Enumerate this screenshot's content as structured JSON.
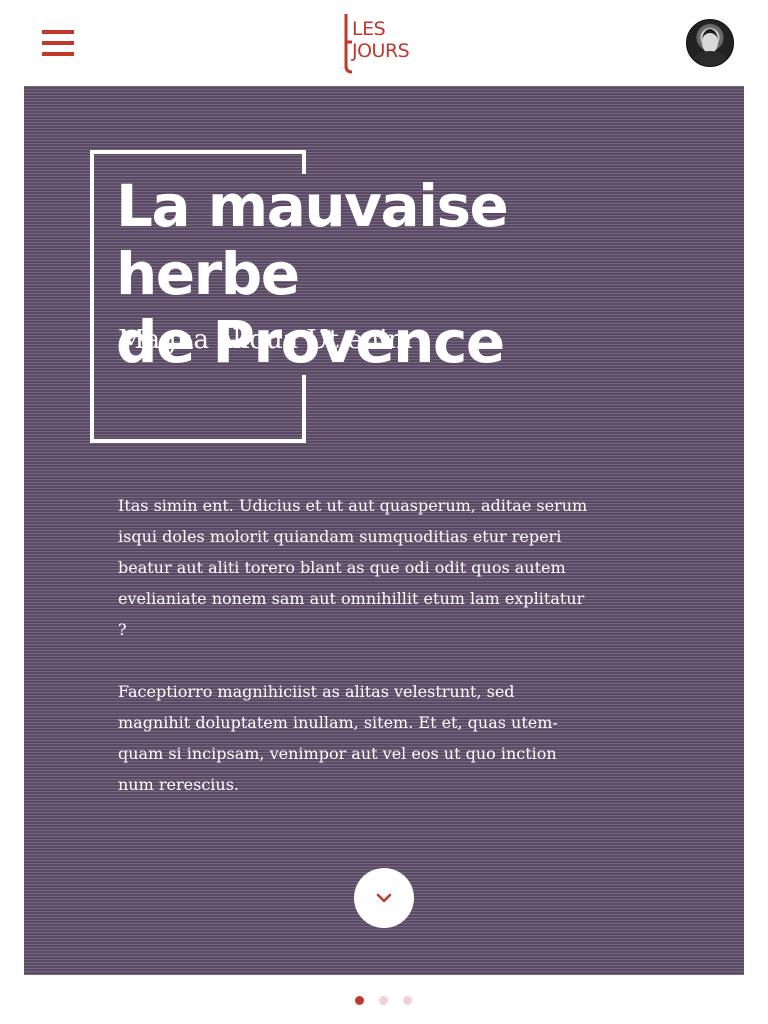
{
  "header": {
    "menu_icon": "hamburger-menu-icon",
    "logo": {
      "top": "LES",
      "bottom": "JOURS"
    },
    "avatar_icon": "user-avatar"
  },
  "hero": {
    "title_line_1": "La mauvaise herbe",
    "title_line_2": "de Provence",
    "subtitle": "Magna aliqua Ut enim",
    "paragraphs": [
      "Itas simin ent. Udicius et ut aut quasperum, aditae serum isqui doles molorit quiandam sumquoditias etur reperi beatur aut aliti torero blant as que odi odit quos autem evelianiate nonem sam aut omnihillit etum lam explitatur ?",
      "Faceptiorro magnihiciist as alitas velestrunt, sed magnihit doluptatem inullam, sitem. Et et, quas utem­quam si incipsam, venimpor aut vel eos ut quo inc­tion num rerescius."
    ],
    "scroll_icon": "chevron-down-icon"
  },
  "pager": {
    "total": 3,
    "active_index": 0
  },
  "colors": {
    "accent": "#c0392b",
    "hero_background": "#5b4a66",
    "dot_inactive": "#f2d0d3",
    "text_on_hero": "#ffffff"
  }
}
